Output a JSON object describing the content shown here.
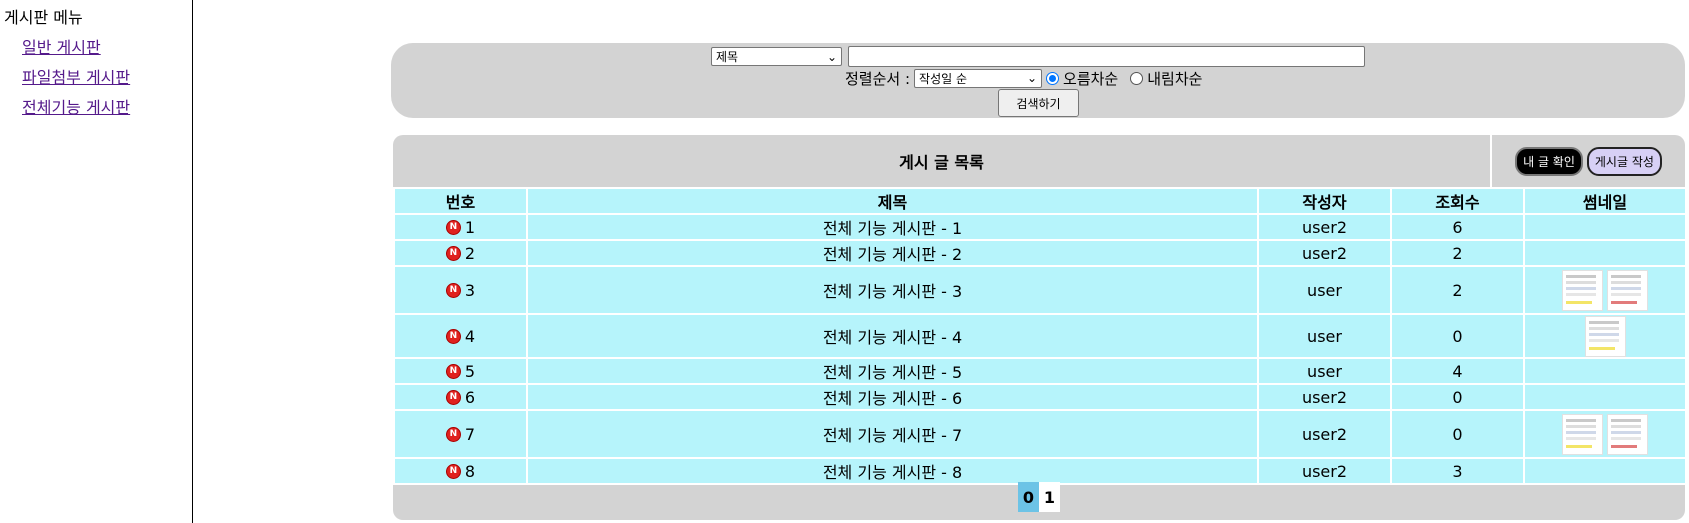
{
  "sidebar": {
    "title": "게시판 메뉴",
    "items": [
      {
        "label": "일반 게시판"
      },
      {
        "label": "파일첨부 게시판"
      },
      {
        "label": "전체기능 게시판"
      }
    ]
  },
  "search": {
    "field_selected": "제목",
    "query_value": "",
    "sort_label": "정렬순서 :",
    "sort_selected": "작성일 순",
    "order_asc": "오름차순",
    "order_desc": "내림차순",
    "submit": "검색하기"
  },
  "board": {
    "title": "게시 글 목록",
    "my_posts": "내 글 확인",
    "write": "게시글 작성",
    "columns": [
      "번호",
      "제목",
      "작성자",
      "조회수",
      "썸네일"
    ],
    "new_badge": "N",
    "rows": [
      {
        "num": "1",
        "title": "전체 기능 게시판 - 1",
        "author": "user2",
        "views": "6",
        "thumbnails": 0
      },
      {
        "num": "2",
        "title": "전체 기능 게시판 - 2",
        "author": "user2",
        "views": "2",
        "thumbnails": 0
      },
      {
        "num": "3",
        "title": "전체 기능 게시판 - 3",
        "author": "user",
        "views": "2",
        "thumbnails": 2
      },
      {
        "num": "4",
        "title": "전체 기능 게시판 - 4",
        "author": "user",
        "views": "0",
        "thumbnails": 1
      },
      {
        "num": "5",
        "title": "전체 기능 게시판 - 5",
        "author": "user",
        "views": "4",
        "thumbnails": 0
      },
      {
        "num": "6",
        "title": "전체 기능 게시판 - 6",
        "author": "user2",
        "views": "0",
        "thumbnails": 0
      },
      {
        "num": "7",
        "title": "전체 기능 게시판 - 7",
        "author": "user2",
        "views": "0",
        "thumbnails": 2
      },
      {
        "num": "8",
        "title": "전체 기능 게시판 - 8",
        "author": "user2",
        "views": "3",
        "thumbnails": 0
      }
    ]
  },
  "pagination": {
    "pages": [
      "0",
      "1"
    ],
    "current": "0"
  }
}
